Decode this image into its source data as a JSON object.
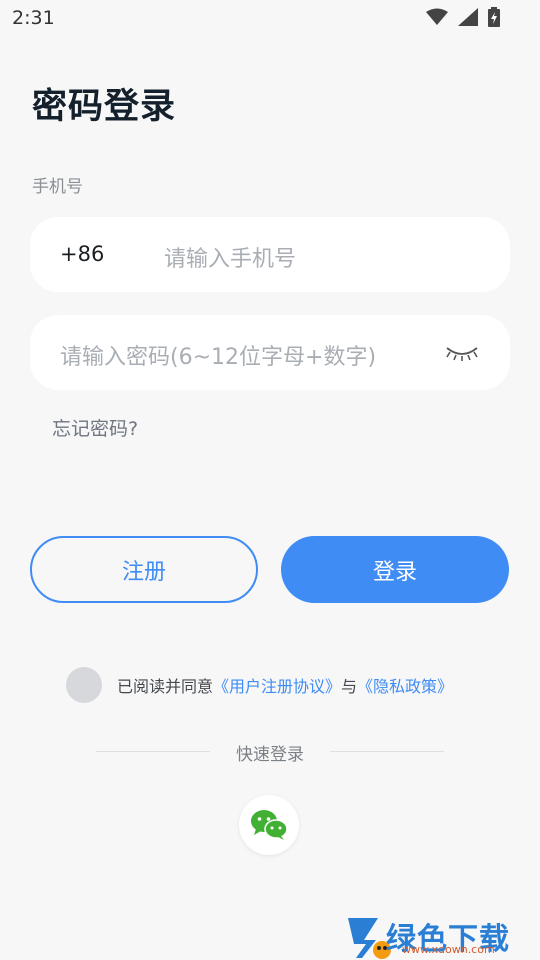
{
  "status_bar": {
    "time": "2:31",
    "icons": [
      "wifi-icon",
      "signal-icon",
      "battery-charging-icon"
    ]
  },
  "page": {
    "title": "密码登录"
  },
  "phone": {
    "label": "手机号",
    "country_code": "+86",
    "placeholder": "请输入手机号"
  },
  "password": {
    "placeholder": "请输入密码(6~12位字母+数字)",
    "toggle_icon": "eye-closed-icon"
  },
  "forgot_label": "忘记密码?",
  "buttons": {
    "register": "注册",
    "login": "登录"
  },
  "agreement": {
    "prefix": "已阅读并同意",
    "user_agreement": "《用户注册协议》",
    "conjunction": "与",
    "privacy_policy": "《隐私政策》",
    "checked": false
  },
  "quick_login": {
    "label": "快速登录",
    "icons": [
      "wechat-icon"
    ]
  },
  "watermark": {
    "title": "绿色下载站",
    "url": "www.xdown.com"
  },
  "colors": {
    "accent": "#3f8cf4",
    "background": "#f7f7f8",
    "wechat": "#41b035"
  }
}
